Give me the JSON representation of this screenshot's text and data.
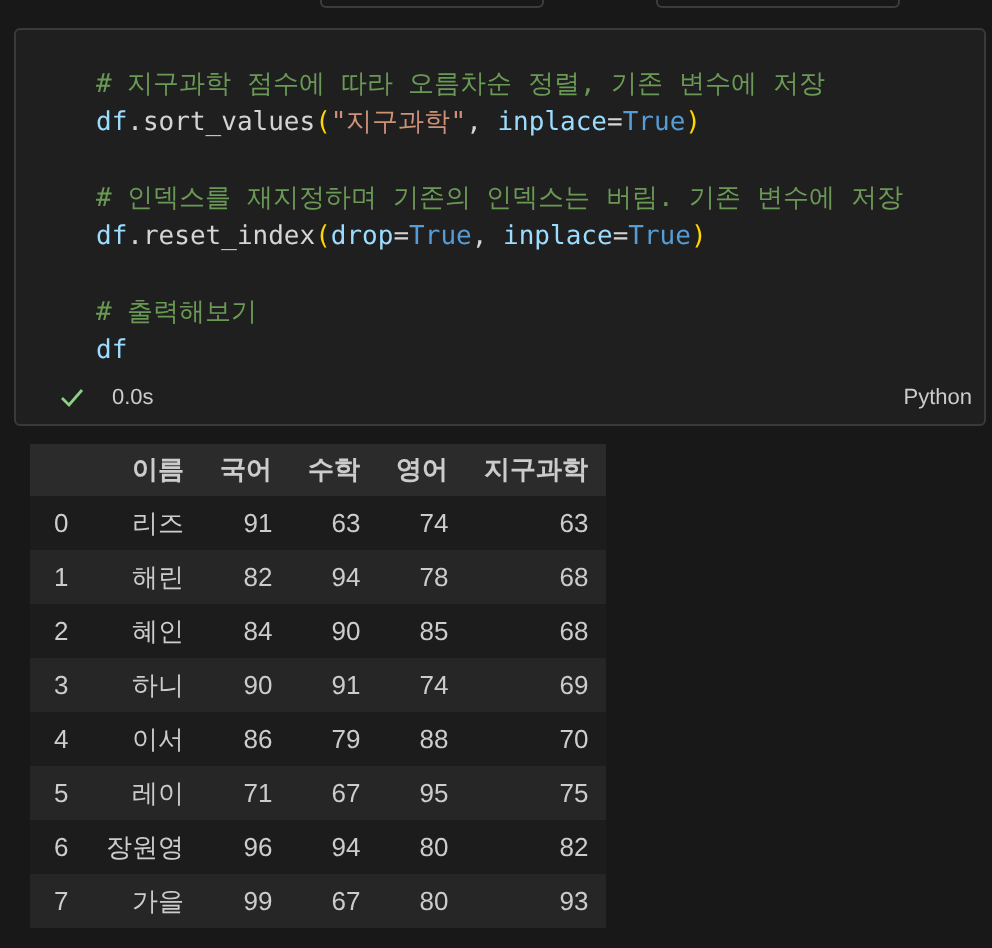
{
  "cell": {
    "code_blocks": [
      [
        [
          {
            "kind": "comment",
            "text": "# 지구과학 점수에 따라 오름차순 정렬, 기존 변수에 저장"
          }
        ],
        [
          {
            "kind": "variable",
            "text": "df"
          },
          {
            "kind": "plain",
            "text": ".sort_values"
          },
          {
            "kind": "bracket",
            "text": "("
          },
          {
            "kind": "string",
            "text": "\"지구과학\""
          },
          {
            "kind": "plain",
            "text": ", "
          },
          {
            "kind": "variable",
            "text": "inplace"
          },
          {
            "kind": "plain",
            "text": "="
          },
          {
            "kind": "constant",
            "text": "True"
          },
          {
            "kind": "bracket",
            "text": ")"
          }
        ]
      ],
      [
        [
          {
            "kind": "comment",
            "text": "# 인덱스를 재지정하며 기존의 인덱스는 버림. 기존 변수에 저장"
          }
        ],
        [
          {
            "kind": "variable",
            "text": "df"
          },
          {
            "kind": "plain",
            "text": ".reset_index"
          },
          {
            "kind": "bracket",
            "text": "("
          },
          {
            "kind": "variable",
            "text": "drop"
          },
          {
            "kind": "plain",
            "text": "="
          },
          {
            "kind": "constant",
            "text": "True"
          },
          {
            "kind": "plain",
            "text": ", "
          },
          {
            "kind": "variable",
            "text": "inplace"
          },
          {
            "kind": "plain",
            "text": "="
          },
          {
            "kind": "constant",
            "text": "True"
          },
          {
            "kind": "bracket",
            "text": ")"
          }
        ]
      ],
      [
        [
          {
            "kind": "comment",
            "text": "# 출력해보기"
          }
        ],
        [
          {
            "kind": "variable",
            "text": "df"
          }
        ]
      ]
    ],
    "status": {
      "succeeded": true,
      "duration": "0.0s",
      "language": "Python"
    }
  },
  "table": {
    "columns": [
      "",
      "이름",
      "국어",
      "수학",
      "영어",
      "지구과학"
    ],
    "rows": [
      [
        "0",
        "리즈",
        "91",
        "63",
        "74",
        "63"
      ],
      [
        "1",
        "해린",
        "82",
        "94",
        "78",
        "68"
      ],
      [
        "2",
        "혜인",
        "84",
        "90",
        "85",
        "68"
      ],
      [
        "3",
        "하니",
        "90",
        "91",
        "74",
        "69"
      ],
      [
        "4",
        "이서",
        "86",
        "79",
        "88",
        "70"
      ],
      [
        "5",
        "레이",
        "71",
        "67",
        "95",
        "75"
      ],
      [
        "6",
        "장원영",
        "96",
        "94",
        "80",
        "82"
      ],
      [
        "7",
        "가을",
        "99",
        "67",
        "80",
        "93"
      ]
    ]
  }
}
